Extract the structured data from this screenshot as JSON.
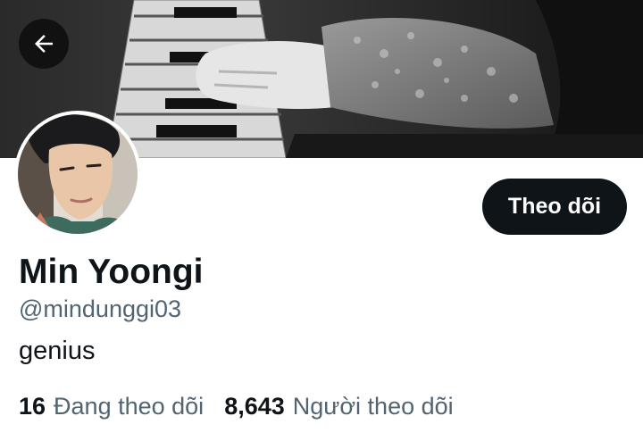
{
  "header": {
    "back_icon": "arrow-left-icon"
  },
  "profile": {
    "name": "Min Yoongi",
    "handle": "@mindunggi03",
    "bio": "genius",
    "follow_label": "Theo dõi"
  },
  "stats": {
    "following_count": "16",
    "following_label": "Đang theo dõi",
    "followers_count": "8,643",
    "followers_label": "Người theo dõi"
  },
  "colors": {
    "primary_text": "#0f1419",
    "secondary_text": "#536471",
    "button_bg": "#0f1419",
    "button_text": "#ffffff"
  }
}
